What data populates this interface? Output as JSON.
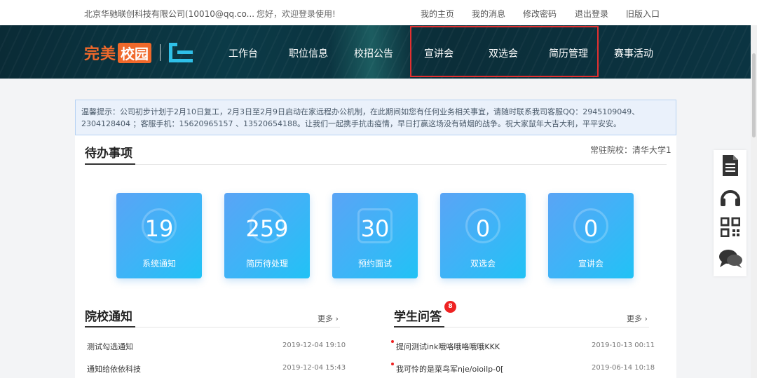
{
  "topbar": {
    "company": "北京华驰联创科技有限公司(10010@qq.co...",
    "welcome": "您好，欢迎登录使用!",
    "links": [
      "我的主页",
      "我的消息",
      "修改密码",
      "退出登录",
      "旧版入口"
    ]
  },
  "logo": {
    "text_main": "完美",
    "text_box": "校园"
  },
  "nav": {
    "items": [
      "工作台",
      "职位信息",
      "校招公告",
      "宣讲会",
      "双选会",
      "简历管理",
      "赛事活动"
    ]
  },
  "notice": {
    "text": "温馨提示：公司初步计划于2月10日复工，2月3日至2月9日启动在家远程办公机制，在此期间如您有任何业务相关事宜，请随时联系我司客服QQ：2945109049、2304128404 ；客服手机：15620965157 、13520654188。让我们一起携手抗击疫情，早日打赢这场没有硝烟的战争。祝大家鼠年大吉大利，平平安安。"
  },
  "todo": {
    "title": "待办事项",
    "school_label": "常驻院校：清华大学1",
    "tiles": [
      {
        "value": "19",
        "label": "系统通知"
      },
      {
        "value": "259",
        "label": "简历待处理"
      },
      {
        "value": "30",
        "label": "预约面试"
      },
      {
        "value": "0",
        "label": "双选会"
      },
      {
        "value": "0",
        "label": "宣讲会"
      }
    ]
  },
  "school_notices": {
    "title": "院校通知",
    "more": "更多",
    "items": [
      {
        "text": "测试勾选通知",
        "date": "2019-12-04 19:10"
      },
      {
        "text": "通知给依依科技",
        "date": "2019-12-04 15:43"
      }
    ]
  },
  "qa": {
    "title": "学生问答",
    "badge": "8",
    "more": "更多",
    "items": [
      {
        "text": "提问测试ink哦咯哦咯哦哦KKK",
        "date": "2019-10-13 00:11"
      },
      {
        "text": "我可怜的是菜鸟军nje/oioilp-0[",
        "date": "2019-06-14 10:18"
      }
    ]
  },
  "sidetools": [
    "document-icon",
    "headset-icon",
    "qrcode-icon",
    "chat-icon"
  ]
}
